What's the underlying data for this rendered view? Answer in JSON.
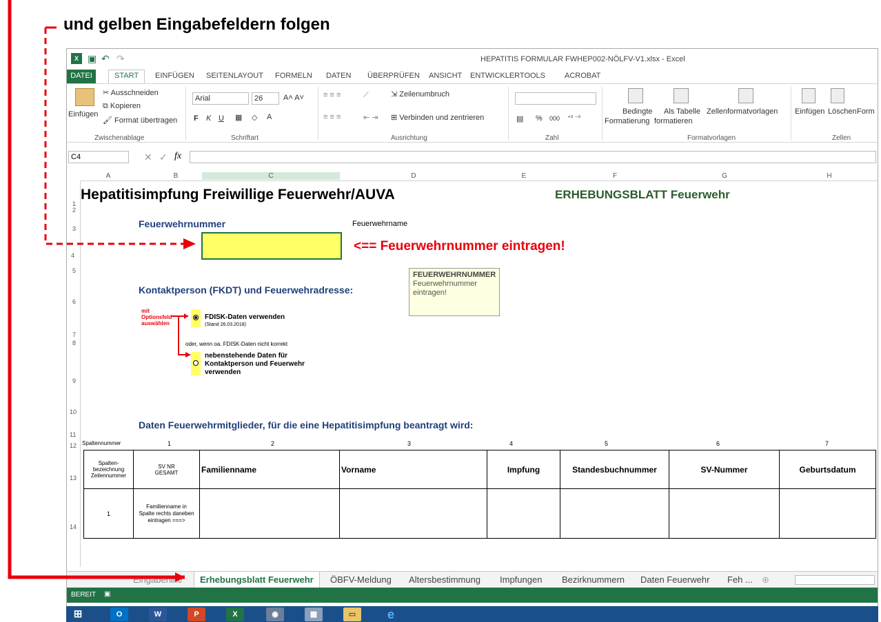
{
  "caption": "und gelben Eingabefeldern folgen",
  "window": {
    "title": "HEPATITIS FORMULAR FWHEP002-NÖLFV-V1.xlsx - Excel"
  },
  "ribbon_tabs": [
    "DATEI",
    "START",
    "EINFÜGEN",
    "SEITENLAYOUT",
    "FORMELN",
    "DATEN",
    "ÜBERPRÜFEN",
    "ANSICHT",
    "ENTWICKLERTOOLS",
    "ACROBAT"
  ],
  "ribbon": {
    "clipboard": {
      "paste": "Einfügen",
      "cut": "Ausschneiden",
      "copy": "Kopieren",
      "format_painter": "Format übertragen",
      "group": "Zwischenablage"
    },
    "font": {
      "name": "Arial",
      "size": "26",
      "bold": "F",
      "italic": "K",
      "underline": "U",
      "group": "Schriftart"
    },
    "alignment": {
      "wrap": "Zeilenumbruch",
      "merge": "Verbinden und zentrieren",
      "group": "Ausrichtung"
    },
    "number": {
      "percent": "%",
      "thousands": "000",
      "group": "Zahl"
    },
    "styles": {
      "cond_line1": "Bedingte",
      "cond_line2": "Formatierung",
      "table_line1": "Als Tabelle",
      "table_line2": "formatieren",
      "cell_styles": "Zellenformatvorlagen",
      "group": "Formatvorlagen"
    },
    "cells": {
      "insert": "Einfügen",
      "delete": "Löschen",
      "format": "Form",
      "group": "Zellen"
    }
  },
  "formula_bar": {
    "name_box": "C4",
    "cancel": "✕",
    "enter": "✓",
    "fx": "fx",
    "value": ""
  },
  "columns": [
    "A",
    "B",
    "C",
    "D",
    "E",
    "F",
    "G",
    "H"
  ],
  "rows": [
    "1",
    "2",
    "3",
    "4",
    "5",
    "6",
    "7",
    "8",
    "9",
    "10",
    "11",
    "12",
    "13",
    "14"
  ],
  "sheet": {
    "title": "Hepatitisimpfung Freiwillige Feuerwehr/AUVA",
    "right_title": "ERHEBUNGSBLATT Feuerwehr",
    "ff_number_label": "Feuerwehrnummer",
    "ff_name_label": "Feuerwehrname",
    "ff_number_value": "",
    "enter_hint": "<== Feuerwehrnummer eintragen!",
    "comment": {
      "title": "FEUERWEHRNUMMER",
      "body": "Feuerwehrnummer eintragen!"
    },
    "contact_heading": "Kontaktperson (FKDT) und Feuerwehradresse:",
    "option_hint": [
      "mit",
      "Optionsfeld",
      "auswählen"
    ],
    "option1_label": "FDISK-Daten verwenden",
    "option1_date": "(Stand 26.03.2018)",
    "or_text": "oder, wenn oa. FDISK-Daten nicht korrekt",
    "option2_label": [
      "nebenstehende Daten für",
      "Kontaktperson und  Feuerwehr",
      "verwenden"
    ],
    "members_heading": "Daten Feuerwehrmitglieder, für die eine Hepatitisimpfung beantragt wird:",
    "col_numbers_label": "Spaltennummer",
    "col_numbers": [
      "1",
      "2",
      "3",
      "4",
      "5",
      "6",
      "7"
    ],
    "table_headers": {
      "row_label": [
        "Spalten-",
        "bezeichnung",
        "Zeilennummer"
      ],
      "sv_nr": [
        "SV NR",
        "GESAMT"
      ],
      "family": "Familienname",
      "first": "Vorname",
      "vaccination": "Impfung",
      "standesbuch": "Standesbuchnummer",
      "sv_number": "SV-Nummer",
      "birth": "Geburtsdatum"
    },
    "data_row": {
      "num": "1",
      "hint": [
        "Familienname in",
        "Spalte rechts daneben",
        "eintragen ===>"
      ]
    }
  },
  "sheet_tabs": [
    "Eingabehilfe",
    "Erhebungsblatt Feuerwehr",
    "ÖBFV-Meldung",
    "Altersbestimmung",
    "Impfungen",
    "Bezirknummern",
    "Daten Feuerwehr",
    "Feh ..."
  ],
  "active_sheet": "Erhebungsblatt Feuerwehr",
  "status": "BEREIT",
  "colors": {
    "excel_green": "#217346",
    "annotation_red": "#e8000b",
    "yellow": "#ffff66",
    "heading_blue": "#1f3f7a",
    "dark_green": "#2a5d2a"
  }
}
